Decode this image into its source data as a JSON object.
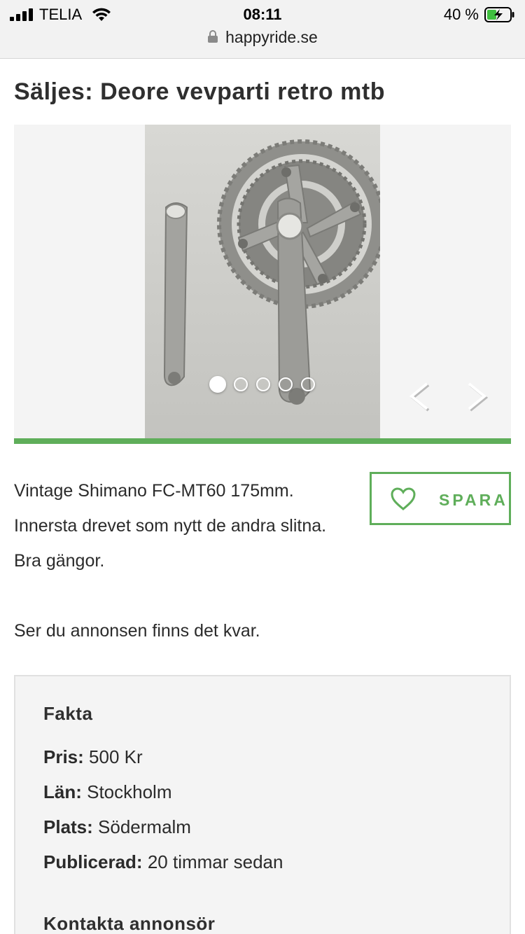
{
  "status_bar": {
    "carrier": "TELIA",
    "time": "08:11",
    "battery_percent": "40 %"
  },
  "browser": {
    "url": "happyride.se"
  },
  "listing": {
    "title": "Säljes: Deore vevparti retro mtb",
    "gallery": {
      "image_count": 5,
      "active_index": 0,
      "image_alt": "Shimano Deore crankset photo"
    },
    "description": [
      "Vintage Shimano FC-MT60 175mm. Innersta drevet som nytt de andra slitna. Bra gängor.",
      "Ser du annonsen finns det kvar."
    ],
    "save_label": "SPARA"
  },
  "facts": {
    "heading": "Fakta",
    "rows": [
      {
        "label": "Pris:",
        "value": "500 Kr"
      },
      {
        "label": "Län:",
        "value": "Stockholm"
      },
      {
        "label": "Plats:",
        "value": "Södermalm"
      },
      {
        "label": "Publicerad:",
        "value": "20 timmar sedan"
      }
    ],
    "contact_heading": "Kontakta annonsör"
  },
  "colors": {
    "accent_green": "#5fae5a",
    "panel_grey": "#f4f4f4"
  },
  "icons": [
    "signal-icon",
    "wifi-icon",
    "battery-charging-icon",
    "lock-icon",
    "chevron-left-icon",
    "chevron-right-icon",
    "heart-icon"
  ]
}
